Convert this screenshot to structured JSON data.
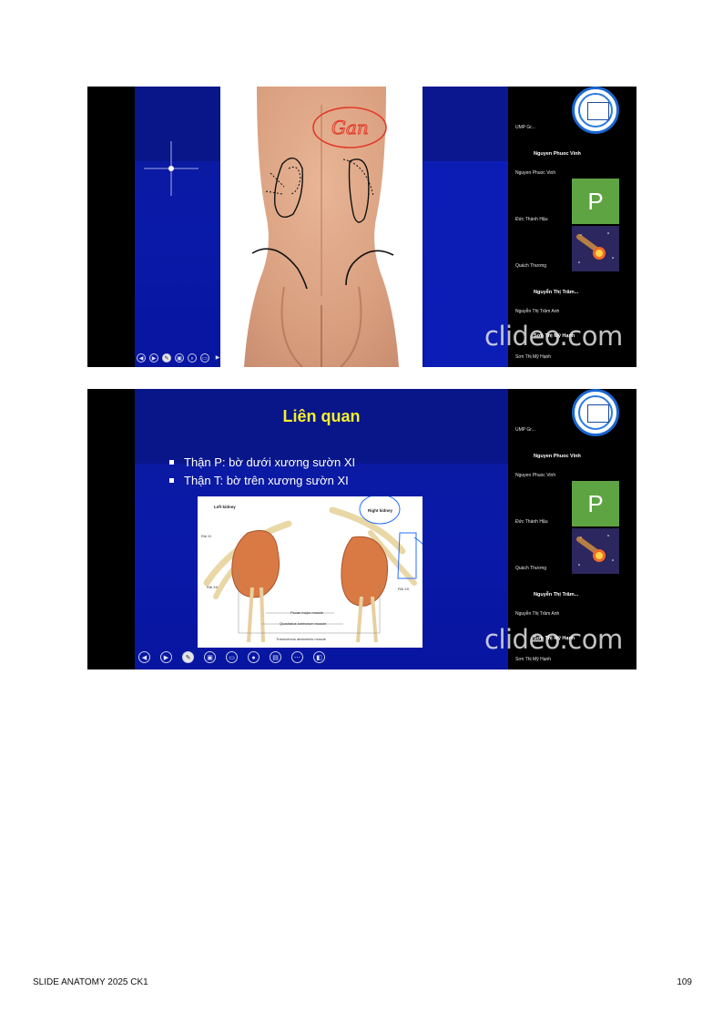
{
  "slide1": {
    "watermark": "clideo.com",
    "annotation_text": "Gan",
    "participants": {
      "row1": "UMP Gr...",
      "name1_bold": "Nguyen Phuoc Vinh",
      "name1": "Nguyen Phuoc Vinh",
      "avatar_letter": "P",
      "name2": "Đức Thành Hậu",
      "name3": "Quách Thương",
      "name4_bold": "Nguyễn Thị Trâm...",
      "name4": "Nguyễn Thị Trâm Anh",
      "name5_bold": "Sơn Thị Mỹ Hạnh",
      "name5": "Sơn Thị Mỹ Hạnh"
    }
  },
  "slide2": {
    "title": "Liên quan",
    "bullets": [
      "Thận P: bờ dưới xương sườn XI",
      "Thận T: bờ trên xương sườn XI"
    ],
    "watermark": "clideo.com",
    "diagram": {
      "left_kidney": "Left kidney",
      "right_kidney": "Right kidney",
      "rib_xi": "Rib XI",
      "rib_xii_left": "Rib XII",
      "rib_xii_right": "Rib XII",
      "psoas": "Psoas major muscle",
      "quadratus": "Quadratus lumborum muscle",
      "transversus": "Transversus abdominis muscle"
    },
    "participants": {
      "row1": "UMP Gr...",
      "name1_bold": "Nguyen Phuoc Vinh",
      "name1": "Nguyen Phuoc Vinh",
      "avatar_letter": "P",
      "name2": "Đức Thành Hậu",
      "name3": "Quách Thương",
      "name4_bold": "Nguyễn Thị Trâm...",
      "name4": "Nguyễn Thị Trâm Anh",
      "name5_bold": "Sơn Thị Mỹ Hạnh",
      "name5": "Sơn Thị Mỹ Hạnh"
    }
  },
  "footer": {
    "left": "SLIDE ANATOMY 2025 CK1",
    "page_number": "109"
  }
}
